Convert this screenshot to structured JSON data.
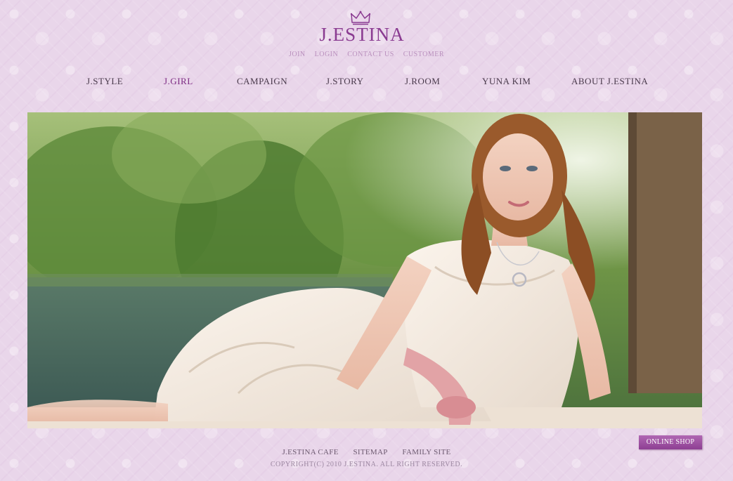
{
  "brand": {
    "logo_text": "J.ESTINA",
    "color": "#8a3b91"
  },
  "util_nav": [
    {
      "label": "JOIN"
    },
    {
      "label": "LOGIN"
    },
    {
      "label": "CONTACT US"
    },
    {
      "label": "CUSTOMER"
    }
  ],
  "main_nav": [
    {
      "label": "J.STYLE"
    },
    {
      "label": "J.GIRL",
      "active": true
    },
    {
      "label": "CAMPAIGN"
    },
    {
      "label": "J.STORY"
    },
    {
      "label": "J.ROOM"
    },
    {
      "label": "YUNA KIM"
    },
    {
      "label": "ABOUT J.ESTINA"
    }
  ],
  "online_shop": {
    "label": "ONLINE SHOP"
  },
  "footer": {
    "links": [
      {
        "label": "J.ESTINA CAFE"
      },
      {
        "label": "SITEMAP"
      },
      {
        "label": "FAMILY SITE"
      }
    ],
    "copyright": "COPYRIGHT(C) 2010 J.ESTINA. ALL RIGHT RESERVED."
  },
  "icons": {
    "crown": "crown-icon"
  },
  "colors": {
    "background": "#e9d6ea",
    "nav_text": "#4a3a4c",
    "nav_active": "#7d2b83",
    "button": "#9b4ca0"
  }
}
